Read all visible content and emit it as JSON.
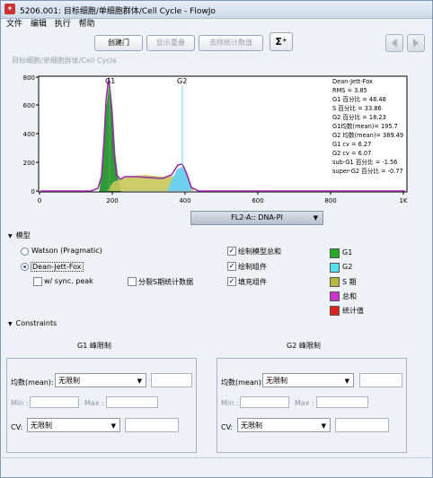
{
  "window": {
    "title": "5206.001: 目标细胞/单细胞群体/Cell Cycle - FlowJo"
  },
  "menu": [
    "文件",
    "编辑",
    "执行",
    "帮助"
  ],
  "toolbar": {
    "create_gate": "创建门",
    "show_overlay": "显示重叠",
    "remove_stats": "去除统计数值",
    "sigma": "Σ⁺"
  },
  "breadcrumb": "目标细胞/单细胞群体/Cell Cycle",
  "histogram": {
    "x_ticks": [
      "0",
      "200",
      "400",
      "600",
      "800",
      "1K"
    ],
    "y_ticks": [
      "0",
      "200",
      "400",
      "600",
      "800"
    ],
    "peak_labels": {
      "g1": "G1",
      "g2": "G2"
    },
    "stats": [
      "Dean-Jett-Fox",
      "RMS = 3.85",
      "G1 百分比 = 48.48",
      "S 百分比 = 33.86",
      "G2 百分比 = 18.23",
      "G1均数(mean)= 195.7",
      "G2 均数(mean)= 389.49",
      "G1 cv = 6.27",
      "G2 cv = 6.07",
      "sub-G1 百分比 = -1.56",
      "super-G2 百分比 = -0.77"
    ],
    "colors": {
      "g1": "#2e9a38",
      "s": "#c6c85a",
      "g2": "#6fd0ee",
      "total": "#9b2aa7",
      "cursor": "#6fd0ee"
    }
  },
  "parameter": "FL2-A:: DNA-PI",
  "model": {
    "header": "模型",
    "watson": "Watson (Pragmatic)",
    "djf": "Dean-Jett-Fox",
    "sync_peak": "w/ sync. peak",
    "split_s": "分裂S期统计数据",
    "draw_model_sum": "绘制模型总和",
    "draw_components": "绘制组件",
    "fill_components": "填充组件"
  },
  "legend": [
    {
      "label": "G1",
      "color": "#22aa22"
    },
    {
      "label": "G2",
      "color": "#55e0f0"
    },
    {
      "label": "S 期",
      "color": "#b8b840"
    },
    {
      "label": "总和",
      "color": "#cc33cc"
    },
    {
      "label": "统计值",
      "color": "#dd2222"
    }
  ],
  "constraints": {
    "header": "Constraints",
    "g1_title": "G1 峰限制",
    "g2_title": "G2 峰限制",
    "mean_label": "均数(mean):",
    "min_label": "Min :",
    "max_label": "Max :",
    "cv_label": "CV:",
    "unlimited": "无限制"
  }
}
